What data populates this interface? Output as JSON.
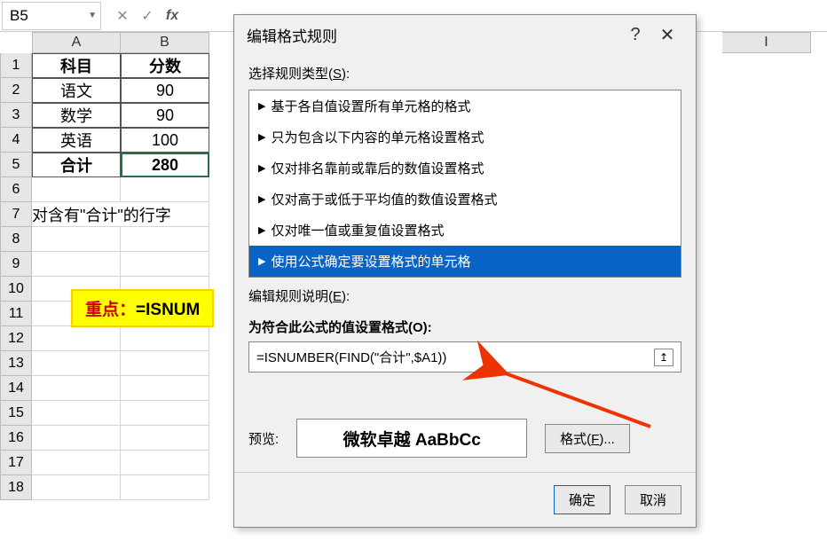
{
  "namebox": {
    "value": "B5"
  },
  "columns": [
    "A",
    "B",
    "I"
  ],
  "table": {
    "headers": [
      "科目",
      "分数"
    ],
    "rows": [
      {
        "subject": "语文",
        "score": "90"
      },
      {
        "subject": "数学",
        "score": "90"
      },
      {
        "subject": "英语",
        "score": "100"
      },
      {
        "subject": "合计",
        "score": "280"
      }
    ]
  },
  "row7_text": "对含有\"合计\"的行字",
  "note": {
    "label": "重点：",
    "tail": "=ISNUM"
  },
  "dialog": {
    "title": "编辑格式规则",
    "section1": "选择规则类型(",
    "section1_u": "S",
    "section1_tail": "):",
    "rule_types": [
      "基于各自值设置所有单元格的格式",
      "只为包含以下内容的单元格设置格式",
      "仅对排名靠前或靠后的数值设置格式",
      "仅对高于或低于平均值的数值设置格式",
      "仅对唯一值或重复值设置格式",
      "使用公式确定要设置格式的单元格"
    ],
    "selected_rule": 5,
    "section2": "编辑规则说明(",
    "section2_u": "E",
    "section2_tail": "):",
    "formula_label": "为符合此公式的值设置格式(",
    "formula_label_u": "O",
    "formula_label_tail": "):",
    "formula": "=ISNUMBER(FIND(\"合计\",$A1))",
    "preview_label": "预览:",
    "preview_text": "微软卓越 AaBbCc",
    "format_btn": "格式(",
    "format_btn_u": "F",
    "format_btn_tail": ")...",
    "ok": "确定",
    "cancel": "取消"
  }
}
